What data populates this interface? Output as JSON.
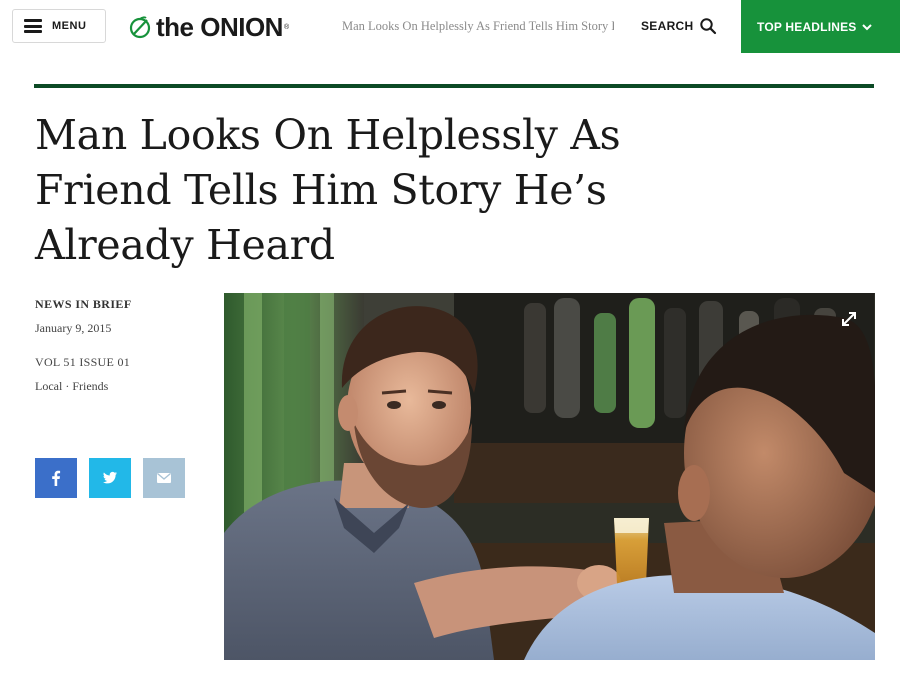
{
  "header": {
    "menu_label": "MENU",
    "logo": "the ONION",
    "ticker": "Man Looks On Helplessly As Friend Tells Him Story He's Already Heard",
    "search_label": "SEARCH",
    "top_headlines_label": "TOP HEADLINES"
  },
  "article": {
    "headline": "Man Looks On Helplessly As Friend Tells Him Story He’s Already Heard",
    "section": "NEWS IN BRIEF",
    "date": "January 9, 2015",
    "issue": "VOL 51 ISSUE 01",
    "tags": [
      "Local",
      "Friends"
    ],
    "tag_separator": " · "
  },
  "share": {
    "facebook": "f",
    "twitter": "twitter-bird-icon",
    "email": "envelope-icon"
  },
  "colors": {
    "brand_green": "#17923b",
    "rule_green": "#0c4a25",
    "facebook_blue": "#3b6fc9",
    "twitter_blue": "#22b8e8",
    "email_grey": "#a8c3d6"
  }
}
